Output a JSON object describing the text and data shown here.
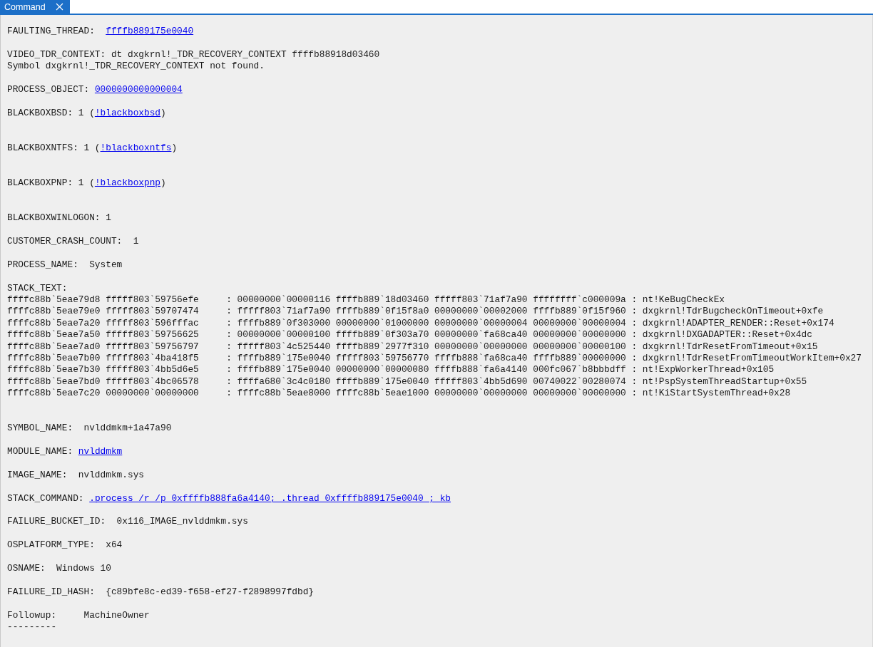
{
  "tabs": [
    {
      "label": "Command",
      "selected": true,
      "closable": true
    }
  ],
  "output": [
    {
      "kind": "mixed",
      "parts": [
        {
          "kind": "plain",
          "text": "FAULTING_THREAD:  "
        },
        {
          "kind": "link",
          "text": "ffffb889175e0040"
        }
      ]
    },
    {
      "kind": "blank"
    },
    {
      "kind": "plain",
      "text": "VIDEO_TDR_CONTEXT: dt dxgkrnl!_TDR_RECOVERY_CONTEXT ffffb88918d03460"
    },
    {
      "kind": "plain",
      "text": "Symbol dxgkrnl!_TDR_RECOVERY_CONTEXT not found."
    },
    {
      "kind": "blank"
    },
    {
      "kind": "mixed",
      "parts": [
        {
          "kind": "plain",
          "text": "PROCESS_OBJECT: "
        },
        {
          "kind": "link",
          "text": "0000000000000004"
        }
      ]
    },
    {
      "kind": "blank"
    },
    {
      "kind": "mixed",
      "parts": [
        {
          "kind": "plain",
          "text": "BLACKBOXBSD: 1 ("
        },
        {
          "kind": "link",
          "text": "!blackboxbsd"
        },
        {
          "kind": "plain",
          "text": ")"
        }
      ]
    },
    {
      "kind": "blank"
    },
    {
      "kind": "blank"
    },
    {
      "kind": "mixed",
      "parts": [
        {
          "kind": "plain",
          "text": "BLACKBOXNTFS: 1 ("
        },
        {
          "kind": "link",
          "text": "!blackboxntfs"
        },
        {
          "kind": "plain",
          "text": ")"
        }
      ]
    },
    {
      "kind": "blank"
    },
    {
      "kind": "blank"
    },
    {
      "kind": "mixed",
      "parts": [
        {
          "kind": "plain",
          "text": "BLACKBOXPNP: 1 ("
        },
        {
          "kind": "link",
          "text": "!blackboxpnp"
        },
        {
          "kind": "plain",
          "text": ")"
        }
      ]
    },
    {
      "kind": "blank"
    },
    {
      "kind": "blank"
    },
    {
      "kind": "plain",
      "text": "BLACKBOXWINLOGON: 1"
    },
    {
      "kind": "blank"
    },
    {
      "kind": "plain",
      "text": "CUSTOMER_CRASH_COUNT:  1"
    },
    {
      "kind": "blank"
    },
    {
      "kind": "plain",
      "text": "PROCESS_NAME:  System"
    },
    {
      "kind": "blank"
    },
    {
      "kind": "plain",
      "text": "STACK_TEXT:"
    },
    {
      "kind": "plain",
      "text": "ffffc88b`5eae79d8 fffff803`59756efe     : 00000000`00000116 ffffb889`18d03460 fffff803`71af7a90 ffffffff`c000009a : nt!KeBugCheckEx"
    },
    {
      "kind": "plain",
      "text": "ffffc88b`5eae79e0 fffff803`59707474     : fffff803`71af7a90 ffffb889`0f15f8a0 00000000`00002000 ffffb889`0f15f960 : dxgkrnl!TdrBugcheckOnTimeout+0xfe"
    },
    {
      "kind": "plain",
      "text": "ffffc88b`5eae7a20 fffff803`596fffac     : ffffb889`0f303000 00000000`01000000 00000000`00000004 00000000`00000004 : dxgkrnl!ADAPTER_RENDER::Reset+0x174"
    },
    {
      "kind": "plain",
      "text": "ffffc88b`5eae7a50 fffff803`59756625     : 00000000`00000100 ffffb889`0f303a70 00000000`fa68ca40 00000000`00000000 : dxgkrnl!DXGADAPTER::Reset+0x4dc"
    },
    {
      "kind": "plain",
      "text": "ffffc88b`5eae7ad0 fffff803`59756797     : fffff803`4c525440 ffffb889`2977f310 00000000`00000000 00000000`00000100 : dxgkrnl!TdrResetFromTimeout+0x15"
    },
    {
      "kind": "plain",
      "text": "ffffc88b`5eae7b00 fffff803`4ba418f5     : ffffb889`175e0040 fffff803`59756770 ffffb888`fa68ca40 ffffb889`00000000 : dxgkrnl!TdrResetFromTimeoutWorkItem+0x27"
    },
    {
      "kind": "plain",
      "text": "ffffc88b`5eae7b30 fffff803`4bb5d6e5     : ffffb889`175e0040 00000000`00000080 ffffb888`fa6a4140 000fc067`b8bbbdff : nt!ExpWorkerThread+0x105"
    },
    {
      "kind": "plain",
      "text": "ffffc88b`5eae7bd0 fffff803`4bc06578     : ffffa680`3c4c0180 ffffb889`175e0040 fffff803`4bb5d690 00740022`00280074 : nt!PspSystemThreadStartup+0x55"
    },
    {
      "kind": "plain",
      "text": "ffffc88b`5eae7c20 00000000`00000000     : ffffc88b`5eae8000 ffffc88b`5eae1000 00000000`00000000 00000000`00000000 : nt!KiStartSystemThread+0x28"
    },
    {
      "kind": "blank"
    },
    {
      "kind": "blank"
    },
    {
      "kind": "plain",
      "text": "SYMBOL_NAME:  nvlddmkm+1a47a90"
    },
    {
      "kind": "blank"
    },
    {
      "kind": "mixed",
      "parts": [
        {
          "kind": "plain",
          "text": "MODULE_NAME: "
        },
        {
          "kind": "link",
          "text": "nvlddmkm"
        }
      ]
    },
    {
      "kind": "blank"
    },
    {
      "kind": "plain",
      "text": "IMAGE_NAME:  nvlddmkm.sys"
    },
    {
      "kind": "blank"
    },
    {
      "kind": "mixed",
      "parts": [
        {
          "kind": "plain",
          "text": "STACK_COMMAND: "
        },
        {
          "kind": "link",
          "text": ".process /r /p 0xffffb888fa6a4140; .thread 0xffffb889175e0040 ; kb"
        }
      ]
    },
    {
      "kind": "blank"
    },
    {
      "kind": "plain",
      "text": "FAILURE_BUCKET_ID:  0x116_IMAGE_nvlddmkm.sys"
    },
    {
      "kind": "blank"
    },
    {
      "kind": "plain",
      "text": "OSPLATFORM_TYPE:  x64"
    },
    {
      "kind": "blank"
    },
    {
      "kind": "plain",
      "text": "OSNAME:  Windows 10"
    },
    {
      "kind": "blank"
    },
    {
      "kind": "plain",
      "text": "FAILURE_ID_HASH:  {c89bfe8c-ed39-f658-ef27-f2898997fdbd}"
    },
    {
      "kind": "blank"
    },
    {
      "kind": "plain",
      "text": "Followup:     MachineOwner"
    },
    {
      "kind": "plain",
      "text": "---------"
    }
  ]
}
